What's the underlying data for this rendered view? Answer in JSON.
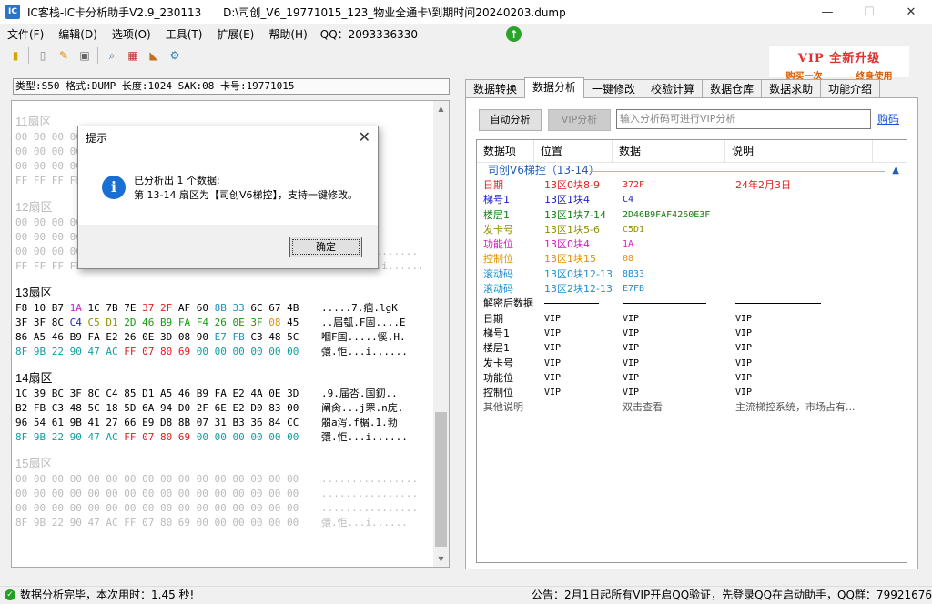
{
  "window": {
    "title": "IC客栈-IC卡分析助手V2.9_230113",
    "path": "D:\\司创_V6_19771015_123_物业全通卡\\到期时间20240203.dump",
    "controls": [
      "—",
      "☐",
      "✕"
    ]
  },
  "menu": {
    "items": [
      "文件(F)",
      "编辑(D)",
      "选项(O)",
      "工具(T)",
      "扩展(E)",
      "帮助(H)"
    ],
    "qq": "QQ：2093336330"
  },
  "vip_banner": {
    "title": "VIP 全新升级",
    "left": "购买一次",
    "right": "终身使用"
  },
  "card_info": "类型:S50 格式:DUMP 长度:1024 SAK:08 卡号:19771015",
  "dialog": {
    "title": "提示",
    "line1": "已分析出 1 个数据:",
    "line2": "第 13-14 扇区为【司创V6梯控】，支持一键修改。",
    "ok": "确定"
  },
  "tabs": [
    "数据转换",
    "数据分析",
    "一键修改",
    "校验计算",
    "数据仓库",
    "数据求助",
    "功能介绍"
  ],
  "analysis": {
    "auto_button": "自动分析",
    "vip_button": "VIP分析",
    "input_placeholder": "输入分析码可进行VIP分析",
    "buy_link": "购码",
    "columns": [
      "数据项",
      "位置",
      "数据",
      "说明"
    ],
    "group_title": "司创V6梯控（13-14）",
    "rows": [
      {
        "name": "日期",
        "pos": "13区0块8-9",
        "data": "372F",
        "desc": "24年2月3日",
        "color": "#e02020"
      },
      {
        "name": "梯号1",
        "pos": "13区1块4",
        "data": "C4",
        "desc": "",
        "color": "#2020d0"
      },
      {
        "name": "楼层1",
        "pos": "13区1块7-14",
        "data": "2D46B9FAF4260E3F",
        "desc": "",
        "color": "#108010"
      },
      {
        "name": "发卡号",
        "pos": "13区1块5-6",
        "data": "C5D1",
        "desc": "",
        "color": "#909000"
      },
      {
        "name": "功能位",
        "pos": "13区0块4",
        "data": "1A",
        "desc": "",
        "color": "#d020c0"
      },
      {
        "name": "控制位",
        "pos": "13区1块15",
        "data": "08",
        "desc": "",
        "color": "#e09000"
      },
      {
        "name": "滚动码",
        "pos": "13区0块12-13",
        "data": "8B33",
        "desc": "",
        "color": "#2090d0"
      },
      {
        "name": "滚动码",
        "pos": "13区2块12-13",
        "data": "E7FB",
        "desc": "",
        "color": "#2090d0"
      }
    ],
    "decrypt_title": "解密后数据",
    "decrypt_rows": [
      {
        "name": "日期",
        "pos": "VIP",
        "data": "VIP",
        "desc": "VIP"
      },
      {
        "name": "梯号1",
        "pos": "VIP",
        "data": "VIP",
        "desc": "VIP"
      },
      {
        "name": "楼层1",
        "pos": "VIP",
        "data": "VIP",
        "desc": "VIP"
      },
      {
        "name": "发卡号",
        "pos": "VIP",
        "data": "VIP",
        "desc": "VIP"
      },
      {
        "name": "功能位",
        "pos": "VIP",
        "data": "VIP",
        "desc": "VIP"
      },
      {
        "name": "控制位",
        "pos": "VIP",
        "data": "VIP",
        "desc": "VIP"
      }
    ],
    "other": {
      "name": "其他说明",
      "data": "双击查看",
      "desc": "主流梯控系统，市场占有..."
    }
  },
  "sectors": [
    {
      "title": "11扇区",
      "dim": true,
      "rows": [
        {
          "hex": "00 00 00 00",
          "ascii": "......"
        },
        {
          "hex": "00 00 00 00",
          "ascii": "......"
        },
        {
          "hex": "00 00 00 00",
          "ascii": "......"
        },
        {
          "hex": "FF FF FF FF",
          "ascii": "......"
        }
      ]
    },
    {
      "title": "12扇区",
      "dim": true,
      "rows": [
        {
          "hex": "00 00 00 00",
          "ascii": "......"
        },
        {
          "hex": "00 00 00 00",
          "ascii": "......"
        },
        {
          "hex": "00 00 00 00 00 00 00 00 00 00 00 00 00 00 00 00",
          "ascii": "................"
        },
        {
          "hex": "FF FF FF FF FF FF FF 07 80 69 FF FF FF FF FF FF",
          "ascii": "..........i......"
        }
      ]
    },
    {
      "title": "13扇区",
      "dim": false,
      "rows": [
        {
          "cells": [
            [
              "F8",
              ""
            ],
            [
              "10",
              ""
            ],
            [
              "B7",
              ""
            ],
            [
              "1A",
              "c-mag"
            ],
            [
              "1C",
              ""
            ],
            [
              "7B",
              ""
            ],
            [
              "7E",
              ""
            ],
            [
              "37",
              "c-red"
            ],
            [
              "2F",
              "c-red"
            ],
            [
              "AF",
              ""
            ],
            [
              "60",
              ""
            ],
            [
              "8B",
              "c-teal"
            ],
            [
              "33",
              "c-teal"
            ],
            [
              "6C",
              ""
            ],
            [
              "67",
              ""
            ],
            [
              "4B",
              ""
            ]
          ],
          "ascii": ".....7.痼.lgK"
        },
        {
          "cells": [
            [
              "3F",
              ""
            ],
            [
              "3F",
              ""
            ],
            [
              "8C",
              ""
            ],
            [
              "C4",
              "c-blue"
            ],
            [
              "C5",
              "c-olive"
            ],
            [
              "D1",
              "c-olive"
            ],
            [
              "2D",
              "c-green"
            ],
            [
              "46",
              "c-green"
            ],
            [
              "B9",
              "c-green"
            ],
            [
              "FA",
              "c-green"
            ],
            [
              "F4",
              "c-green"
            ],
            [
              "26",
              "c-green"
            ],
            [
              "0E",
              "c-green"
            ],
            [
              "3F",
              "c-green"
            ],
            [
              "08",
              "c-orange"
            ],
            [
              "45",
              ""
            ]
          ],
          "ascii": "..届瓠.F固....E"
        },
        {
          "cells": [
            [
              "86",
              ""
            ],
            [
              "A5",
              ""
            ],
            [
              "46",
              ""
            ],
            [
              "B9",
              ""
            ],
            [
              "FA",
              ""
            ],
            [
              "E2",
              ""
            ],
            [
              "26",
              ""
            ],
            [
              "0E",
              ""
            ],
            [
              "3D",
              ""
            ],
            [
              "08",
              ""
            ],
            [
              "90",
              ""
            ],
            [
              "E7",
              "c-teal"
            ],
            [
              "FB",
              "c-teal"
            ],
            [
              "C3",
              ""
            ],
            [
              "48",
              ""
            ],
            [
              "5C",
              ""
            ]
          ],
          "ascii": "嗰F国.....慀.H."
        },
        {
          "cells": [
            [
              "8F",
              "c-cyan"
            ],
            [
              "9B",
              "c-cyan"
            ],
            [
              "22",
              "c-cyan"
            ],
            [
              "90",
              "c-cyan"
            ],
            [
              "47",
              "c-cyan"
            ],
            [
              "AC",
              "c-cyan"
            ],
            [
              "FF",
              "c-red"
            ],
            [
              "07",
              "c-red"
            ],
            [
              "80",
              "c-red"
            ],
            [
              "69",
              "c-red"
            ],
            [
              "00",
              "c-cyan"
            ],
            [
              "00",
              "c-cyan"
            ],
            [
              "00",
              "c-cyan"
            ],
            [
              "00",
              "c-cyan"
            ],
            [
              "00",
              "c-cyan"
            ],
            [
              "00",
              "c-cyan"
            ]
          ],
          "ascii": "彋.怇...i......"
        }
      ]
    },
    {
      "title": "14扇区",
      "dim": false,
      "rows": [
        {
          "cells": [
            [
              "1C",
              ""
            ],
            [
              "39",
              ""
            ],
            [
              "BC",
              ""
            ],
            [
              "3F",
              ""
            ],
            [
              "8C",
              ""
            ],
            [
              "C4",
              ""
            ],
            [
              "85",
              ""
            ],
            [
              "D1",
              ""
            ],
            [
              "A5",
              ""
            ],
            [
              "46",
              ""
            ],
            [
              "B9",
              ""
            ],
            [
              "FA",
              ""
            ],
            [
              "E2",
              ""
            ],
            [
              "4A",
              ""
            ],
            [
              "0E",
              ""
            ],
            [
              "3D",
              ""
            ]
          ],
          "ascii": ".9.届呇.国釖.."
        },
        {
          "cells": [
            [
              "B2",
              ""
            ],
            [
              "FB",
              ""
            ],
            [
              "C3",
              ""
            ],
            [
              "48",
              ""
            ],
            [
              "5C",
              ""
            ],
            [
              "18",
              ""
            ],
            [
              "5D",
              ""
            ],
            [
              "6A",
              ""
            ],
            [
              "94",
              ""
            ],
            [
              "D0",
              ""
            ],
            [
              "2F",
              ""
            ],
            [
              "6E",
              ""
            ],
            [
              "E2",
              ""
            ],
            [
              "D0",
              ""
            ],
            [
              "83",
              ""
            ],
            [
              "00",
              ""
            ]
          ],
          "ascii": "阐肏...j罘.n庑."
        },
        {
          "cells": [
            [
              "96",
              ""
            ],
            [
              "54",
              ""
            ],
            [
              "61",
              ""
            ],
            [
              "9B",
              ""
            ],
            [
              "41",
              ""
            ],
            [
              "27",
              ""
            ],
            [
              "66",
              ""
            ],
            [
              "E9",
              ""
            ],
            [
              "D8",
              ""
            ],
            [
              "8B",
              ""
            ],
            [
              "07",
              ""
            ],
            [
              "31",
              ""
            ],
            [
              "B3",
              ""
            ],
            [
              "36",
              ""
            ],
            [
              "84",
              ""
            ],
            [
              "CC",
              ""
            ]
          ],
          "ascii": "朤a泻.f榍.1.勃"
        },
        {
          "cells": [
            [
              "8F",
              "c-cyan"
            ],
            [
              "9B",
              "c-cyan"
            ],
            [
              "22",
              "c-cyan"
            ],
            [
              "90",
              "c-cyan"
            ],
            [
              "47",
              "c-cyan"
            ],
            [
              "AC",
              "c-cyan"
            ],
            [
              "FF",
              "c-red"
            ],
            [
              "07",
              "c-red"
            ],
            [
              "80",
              "c-red"
            ],
            [
              "69",
              "c-red"
            ],
            [
              "00",
              "c-cyan"
            ],
            [
              "00",
              "c-cyan"
            ],
            [
              "00",
              "c-cyan"
            ],
            [
              "00",
              "c-cyan"
            ],
            [
              "00",
              "c-cyan"
            ],
            [
              "00",
              "c-cyan"
            ]
          ],
          "ascii": "彋.怇...i......"
        }
      ]
    },
    {
      "title": "15扇区",
      "dim": true,
      "rows": [
        {
          "hex": "00 00 00 00 00 00 00 00 00 00 00 00 00 00 00 00",
          "ascii": "................"
        },
        {
          "hex": "00 00 00 00 00 00 00 00 00 00 00 00 00 00 00 00",
          "ascii": "................"
        },
        {
          "hex": "00 00 00 00 00 00 00 00 00 00 00 00 00 00 00 00",
          "ascii": "................"
        },
        {
          "hex": "8F 9B 22 90 47 AC FF 07 80 69 00 00 00 00 00 00",
          "ascii": "彋.怇...i......"
        }
      ]
    }
  ],
  "status": {
    "left": "数据分析完毕，本次用时：1.45 秒!",
    "right": "公告：2月1日起所有VIP开启QQ验证，先登录QQ在启动助手，QQ群：799216763"
  }
}
